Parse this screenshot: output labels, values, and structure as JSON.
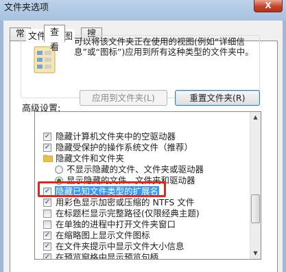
{
  "window": {
    "title": "文件夹选项",
    "close_label": "X"
  },
  "tabs": [
    {
      "label": "常规"
    },
    {
      "label": "查看"
    },
    {
      "label": "搜索"
    }
  ],
  "folder_views": {
    "group_label": "文件夹视图",
    "description": "可以将该文件夹正在使用的视图(例如“详细信息”或“图标”)应用到所有这种类型的文件夹中。",
    "apply_button": "应用到文件夹(L)",
    "reset_button": "重置文件夹(R)"
  },
  "advanced": {
    "label": "高级设置:",
    "items": [
      {
        "type": "checkbox",
        "checked": true,
        "label": "隐藏计算机文件夹中的空驱动器"
      },
      {
        "type": "checkbox",
        "checked": true,
        "label": "隐藏受保护的操作系统文件（推荐）"
      },
      {
        "type": "folder",
        "label": "隐藏文件和文件夹"
      },
      {
        "type": "radio",
        "checked": false,
        "label": "不显示隐藏的文件、文件夹或驱动器"
      },
      {
        "type": "radio",
        "checked": true,
        "label": "显示隐藏的文件、文件夹和驱动器"
      },
      {
        "type": "checkbox",
        "checked": true,
        "label": "隐藏已知文件类型的扩展名"
      },
      {
        "type": "checkbox",
        "checked": true,
        "label": "用彩色显示加密或压缩的 NTFS 文件"
      },
      {
        "type": "checkbox",
        "checked": false,
        "label": "在标题栏显示完整路径(仅限经典主题)"
      },
      {
        "type": "checkbox",
        "checked": false,
        "label": "在单独的进程中打开文件夹窗口"
      },
      {
        "type": "checkbox",
        "checked": true,
        "label": "在缩略图上显示文件图标"
      },
      {
        "type": "checkbox",
        "checked": true,
        "label": "在文件夹提示中显示文件大小信息"
      },
      {
        "type": "checkbox",
        "checked": true,
        "label": "在预览窗格中显示预览句柄"
      }
    ]
  },
  "colors": {
    "highlight": "#3399ff",
    "annotation_box": "#e8241b"
  }
}
